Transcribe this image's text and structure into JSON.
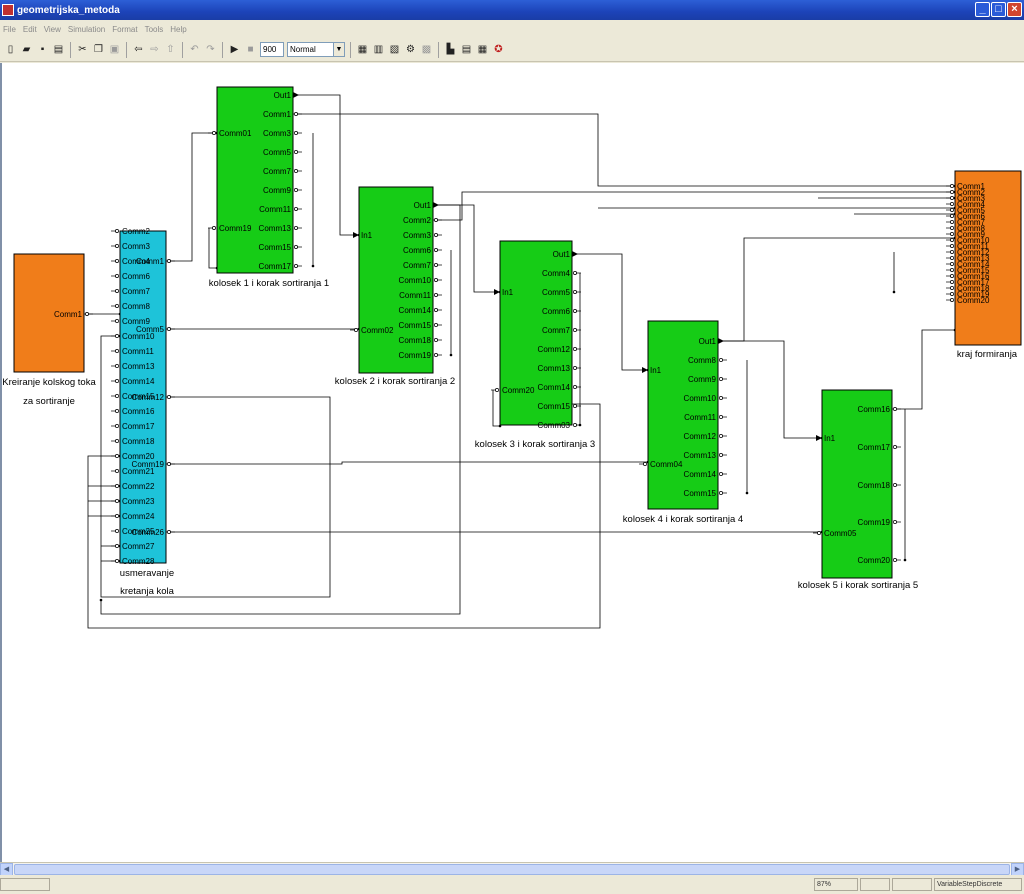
{
  "window": {
    "title": "geometrijska_metoda"
  },
  "menu": [
    "File",
    "Edit",
    "View",
    "Simulation",
    "Format",
    "Tools",
    "Help"
  ],
  "toolbar": {
    "stop_time": "900",
    "sim_mode": "Normal",
    "icons": [
      "new-icon",
      "open-icon",
      "save-icon",
      "print-icon",
      "cut-icon",
      "copy-icon",
      "paste-icon",
      "back-icon",
      "forward-icon",
      "up-icon",
      "undo-icon",
      "redo-icon",
      "start-simulation-icon",
      "stop-simulation-icon",
      "build-icon",
      "update-icon",
      "library-browser-icon",
      "debug-icon",
      "model-explorer-icon",
      "toggle-model-icon",
      "model-advisor-icon",
      "help-icon"
    ]
  },
  "colors": {
    "orange": "#f07d1a",
    "cyan": "#1ec3d9",
    "green": "#16cc16"
  },
  "blocks": [
    {
      "id": "kreiranje",
      "color": "orange",
      "label": [
        "Kreiranje kolskog toka",
        "za sortiranje"
      ],
      "right_ports": [
        {
          "name": "Comm1",
          "kind": "conn"
        }
      ],
      "left_ports": []
    },
    {
      "id": "usmeravanje",
      "color": "cyan",
      "label": [
        "usmeravanje",
        "kretanja kola"
      ],
      "left_ports": [
        {
          "name": "Comm2",
          "kind": "conn"
        },
        {
          "name": "Comm3",
          "kind": "conn"
        },
        {
          "name": "Comm4",
          "kind": "conn"
        },
        {
          "name": "Comm6",
          "kind": "conn"
        },
        {
          "name": "Comm7",
          "kind": "conn"
        },
        {
          "name": "Comm8",
          "kind": "conn"
        },
        {
          "name": "Comm9",
          "kind": "conn"
        },
        {
          "name": "Comm10",
          "kind": "conn"
        },
        {
          "name": "Comm11",
          "kind": "conn"
        },
        {
          "name": "Comm13",
          "kind": "conn"
        },
        {
          "name": "Comm14",
          "kind": "conn"
        },
        {
          "name": "Comm15",
          "kind": "conn"
        },
        {
          "name": "Comm16",
          "kind": "conn"
        },
        {
          "name": "Comm17",
          "kind": "conn"
        },
        {
          "name": "Comm18",
          "kind": "conn"
        },
        {
          "name": "Comm20",
          "kind": "conn"
        },
        {
          "name": "Comm21",
          "kind": "conn"
        },
        {
          "name": "Comm22",
          "kind": "conn"
        },
        {
          "name": "Comm23",
          "kind": "conn"
        },
        {
          "name": "Comm24",
          "kind": "conn"
        },
        {
          "name": "Comm25",
          "kind": "conn"
        },
        {
          "name": "Comm27",
          "kind": "conn"
        },
        {
          "name": "Comm28",
          "kind": "conn"
        }
      ],
      "right_ports": [
        {
          "name": "Comm1",
          "kind": "conn"
        },
        {
          "name": "Comm5",
          "kind": "conn"
        },
        {
          "name": "Comm12",
          "kind": "conn"
        },
        {
          "name": "Comm19",
          "kind": "conn"
        },
        {
          "name": "Comm26",
          "kind": "conn"
        }
      ]
    },
    {
      "id": "kolosek1",
      "color": "green",
      "label": [
        "kolosek 1 i korak sortiranja 1"
      ],
      "left_ports": [
        {
          "name": "Comm01",
          "kind": "conn"
        },
        {
          "name": "Comm19",
          "kind": "conn"
        }
      ],
      "right_ports": [
        {
          "name": "Out1",
          "kind": "out"
        },
        {
          "name": "Comm1",
          "kind": "conn"
        },
        {
          "name": "Comm3",
          "kind": "conn"
        },
        {
          "name": "Comm5",
          "kind": "conn"
        },
        {
          "name": "Comm7",
          "kind": "conn"
        },
        {
          "name": "Comm9",
          "kind": "conn"
        },
        {
          "name": "Comm11",
          "kind": "conn"
        },
        {
          "name": "Comm13",
          "kind": "conn"
        },
        {
          "name": "Comm15",
          "kind": "conn"
        },
        {
          "name": "Comm17",
          "kind": "conn"
        }
      ]
    },
    {
      "id": "kolosek2",
      "color": "green",
      "label": [
        "kolosek 2 i korak sortiranja 2"
      ],
      "left_ports": [
        {
          "name": "In1",
          "kind": "in"
        },
        {
          "name": "Comm02",
          "kind": "conn"
        }
      ],
      "right_ports": [
        {
          "name": "Out1",
          "kind": "out"
        },
        {
          "name": "Comm2",
          "kind": "conn"
        },
        {
          "name": "Comm3",
          "kind": "conn"
        },
        {
          "name": "Comm6",
          "kind": "conn"
        },
        {
          "name": "Comm7",
          "kind": "conn"
        },
        {
          "name": "Comm10",
          "kind": "conn"
        },
        {
          "name": "Comm11",
          "kind": "conn"
        },
        {
          "name": "Comm14",
          "kind": "conn"
        },
        {
          "name": "Comm15",
          "kind": "conn"
        },
        {
          "name": "Comm18",
          "kind": "conn"
        },
        {
          "name": "Comm19",
          "kind": "conn"
        }
      ]
    },
    {
      "id": "kolosek3",
      "color": "green",
      "label": [
        "kolosek 3 i korak sortiranja 3"
      ],
      "left_ports": [
        {
          "name": "In1",
          "kind": "in"
        },
        {
          "name": "Comm20",
          "kind": "conn"
        }
      ],
      "right_ports": [
        {
          "name": "Out1",
          "kind": "out"
        },
        {
          "name": "Comm4",
          "kind": "conn"
        },
        {
          "name": "Comm5",
          "kind": "conn"
        },
        {
          "name": "Comm6",
          "kind": "conn"
        },
        {
          "name": "Comm7",
          "kind": "conn"
        },
        {
          "name": "Comm12",
          "kind": "conn"
        },
        {
          "name": "Comm13",
          "kind": "conn"
        },
        {
          "name": "Comm14",
          "kind": "conn"
        },
        {
          "name": "Comm15",
          "kind": "conn"
        },
        {
          "name": "Comm03",
          "kind": "conn"
        }
      ]
    },
    {
      "id": "kolosek4",
      "color": "green",
      "label": [
        "kolosek 4 i korak sortiranja 4"
      ],
      "left_ports": [
        {
          "name": "In1",
          "kind": "in"
        },
        {
          "name": "Comm04",
          "kind": "conn"
        }
      ],
      "right_ports": [
        {
          "name": "Out1",
          "kind": "out"
        },
        {
          "name": "Comm8",
          "kind": "conn"
        },
        {
          "name": "Comm9",
          "kind": "conn"
        },
        {
          "name": "Comm10",
          "kind": "conn"
        },
        {
          "name": "Comm11",
          "kind": "conn"
        },
        {
          "name": "Comm12",
          "kind": "conn"
        },
        {
          "name": "Comm13",
          "kind": "conn"
        },
        {
          "name": "Comm14",
          "kind": "conn"
        },
        {
          "name": "Comm15",
          "kind": "conn"
        }
      ]
    },
    {
      "id": "kolosek5",
      "color": "green",
      "label": [
        "kolosek 5 i korak sortiranja 5"
      ],
      "left_ports": [
        {
          "name": "In1",
          "kind": "in"
        },
        {
          "name": "Comm05",
          "kind": "conn"
        }
      ],
      "right_ports": [
        {
          "name": "Comm16",
          "kind": "conn"
        },
        {
          "name": "Comm17",
          "kind": "conn"
        },
        {
          "name": "Comm18",
          "kind": "conn"
        },
        {
          "name": "Comm19",
          "kind": "conn"
        },
        {
          "name": "Comm20",
          "kind": "conn"
        }
      ]
    },
    {
      "id": "kraj",
      "color": "orange",
      "label": [
        "kraj formiranja"
      ],
      "left_ports": [
        {
          "name": "Comm1",
          "kind": "conn"
        },
        {
          "name": "Comm2",
          "kind": "conn"
        },
        {
          "name": "Comm3",
          "kind": "conn"
        },
        {
          "name": "Comm4",
          "kind": "conn"
        },
        {
          "name": "Comm5",
          "kind": "conn"
        },
        {
          "name": "Comm6",
          "kind": "conn"
        },
        {
          "name": "Comm7",
          "kind": "conn"
        },
        {
          "name": "Comm8",
          "kind": "conn"
        },
        {
          "name": "Comm9",
          "kind": "conn"
        },
        {
          "name": "Comm10",
          "kind": "conn"
        },
        {
          "name": "Comm11",
          "kind": "conn"
        },
        {
          "name": "Comm12",
          "kind": "conn"
        },
        {
          "name": "Comm13",
          "kind": "conn"
        },
        {
          "name": "Comm14",
          "kind": "conn"
        },
        {
          "name": "Comm15",
          "kind": "conn"
        },
        {
          "name": "Comm16",
          "kind": "conn"
        },
        {
          "name": "Comm17",
          "kind": "conn"
        },
        {
          "name": "Comm18",
          "kind": "conn"
        },
        {
          "name": "Comm19",
          "kind": "conn"
        },
        {
          "name": "Comm20",
          "kind": "conn"
        }
      ],
      "right_ports": []
    }
  ],
  "status": {
    "zoom": "87%",
    "solver": "VariableStepDiscrete"
  }
}
